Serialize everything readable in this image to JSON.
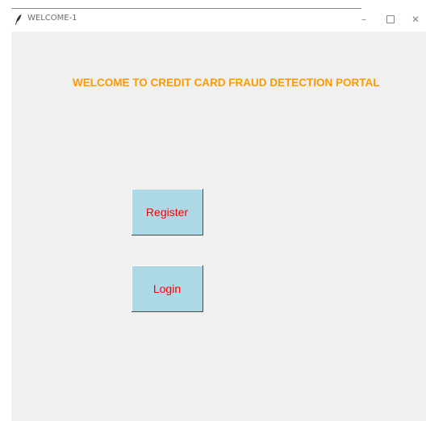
{
  "window": {
    "title": "WELCOME-1",
    "controls": {
      "minimize": "–",
      "maximize": "",
      "close": "✕"
    },
    "icon": "feather-icon"
  },
  "main": {
    "heading": "WELCOME TO CREDIT CARD FRAUD DETECTION PORTAL",
    "heading_color": "#ff9900",
    "background": "#f0f0f0"
  },
  "buttons": {
    "register_label": "Register",
    "login_label": "Login",
    "background": "#add8e6",
    "text_color": "#ff0000"
  }
}
